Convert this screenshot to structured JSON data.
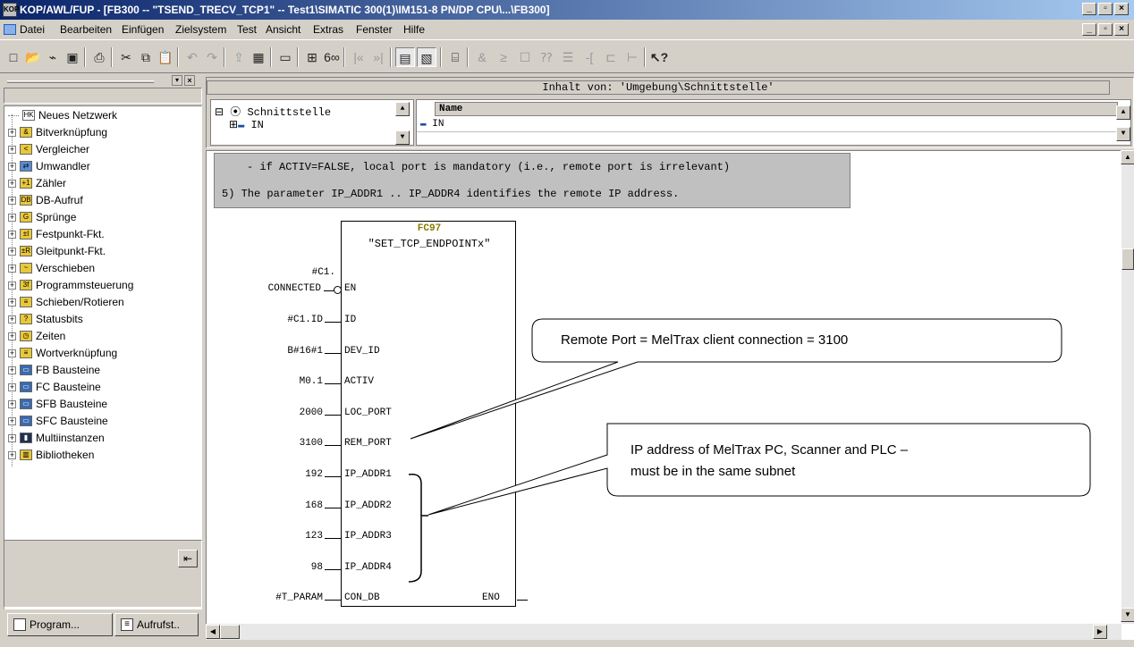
{
  "window": {
    "title": "KOP/AWL/FUP - [FB300 -- \"TSEND_TRECV_TCP1\" -- Test1\\SIMATIC 300(1)\\IM151-8 PN/DP CPU\\...\\FB300]"
  },
  "menu": [
    "Datei",
    "Bearbeiten",
    "Einfügen",
    "Zielsystem",
    "Test",
    "Ansicht",
    "Extras",
    "Fenster",
    "Hilfe"
  ],
  "toolbar_icons": [
    "new-icon",
    "open-icon",
    "accessible-nodes-icon",
    "save-icon",
    "print-icon",
    "cut-icon",
    "copy-icon",
    "paste-icon",
    "undo-icon",
    "redo-icon",
    "load-icon",
    "load-cpu-icon",
    "online-offline-icon",
    "monitor-icon",
    "glasses-icon",
    "prev-network-icon",
    "next-network-icon",
    "overview-icon",
    "details-icon",
    "network-icon",
    "and-box-icon",
    "or-box-icon",
    "empty-box-icon",
    "branch-icon",
    "open-branch-icon",
    "coil-icon",
    "contact-icon",
    "help-icon"
  ],
  "left_panel": {
    "tree": [
      {
        "label": "Neues Netzwerk",
        "icon": "new-network-icon",
        "expand": false
      },
      {
        "label": "Bitverknüpfung",
        "icon": "bit-logic-icon",
        "expand": true
      },
      {
        "label": "Vergleicher",
        "icon": "comparator-icon",
        "expand": true
      },
      {
        "label": "Umwandler",
        "icon": "converter-icon",
        "expand": true
      },
      {
        "label": "Zähler",
        "icon": "counter-icon",
        "expand": true
      },
      {
        "label": "DB-Aufruf",
        "icon": "db-call-icon",
        "expand": true
      },
      {
        "label": "Sprünge",
        "icon": "jump-icon",
        "expand": true
      },
      {
        "label": "Festpunkt-Fkt.",
        "icon": "fixed-point-icon",
        "expand": true
      },
      {
        "label": "Gleitpunkt-Fkt.",
        "icon": "floating-point-icon",
        "expand": true
      },
      {
        "label": "Verschieben",
        "icon": "move-icon",
        "expand": true
      },
      {
        "label": "Programmsteuerung",
        "icon": "program-control-icon",
        "expand": true
      },
      {
        "label": "Schieben/Rotieren",
        "icon": "shift-rotate-icon",
        "expand": true
      },
      {
        "label": "Statusbits",
        "icon": "status-bits-icon",
        "expand": true
      },
      {
        "label": "Zeiten",
        "icon": "timer-icon",
        "expand": true
      },
      {
        "label": "Wortverknüpfung",
        "icon": "word-logic-icon",
        "expand": true
      },
      {
        "label": "FB Bausteine",
        "icon": "fb-block-icon",
        "expand": true
      },
      {
        "label": "FC Bausteine",
        "icon": "fc-block-icon",
        "expand": true
      },
      {
        "label": "SFB Bausteine",
        "icon": "sfb-block-icon",
        "expand": true
      },
      {
        "label": "SFC Bausteine",
        "icon": "sfc-block-icon",
        "expand": true
      },
      {
        "label": "Multiinstanzen",
        "icon": "multi-instance-icon",
        "expand": true
      },
      {
        "label": "Bibliotheken",
        "icon": "library-icon",
        "expand": true
      }
    ],
    "tabs": [
      "Program...",
      "Aufrufst.."
    ]
  },
  "interface": {
    "header": "Inhalt von: 'Umgebung\\Schnittstelle'",
    "tree_root": "Schnittstelle",
    "tree_child": "IN",
    "grid_header": "Name",
    "grid_row": "IN"
  },
  "comment": {
    "line1": "- if ACTIV=FALSE, local port is mandatory (i.e., remote port is irrelevant)",
    "line2": "5) The parameter IP_ADDR1 .. IP_ADDR4 identifies the remote IP address."
  },
  "block": {
    "number": "FC97",
    "name": "\"SET_TCP_ENDPOINTx\"",
    "inputs": [
      {
        "param": "EN",
        "value1": "#C1.",
        "value2": "CONNECTED"
      },
      {
        "param": "ID",
        "value": "#C1.ID"
      },
      {
        "param": "DEV_ID",
        "value": "B#16#1"
      },
      {
        "param": "ACTIV",
        "value": "M0.1"
      },
      {
        "param": "LOC_PORT",
        "value": "2000"
      },
      {
        "param": "REM_PORT",
        "value": "3100"
      },
      {
        "param": "IP_ADDR1",
        "value": "192"
      },
      {
        "param": "IP_ADDR2",
        "value": "168"
      },
      {
        "param": "IP_ADDR3",
        "value": "123"
      },
      {
        "param": "IP_ADDR4",
        "value": "98"
      },
      {
        "param": "CON_DB",
        "value": "#T_PARAM"
      }
    ],
    "output": "ENO"
  },
  "callouts": {
    "remote_port": "Remote Port = MelTrax client connection = 3100",
    "ip_line1": "IP address of MelTrax PC, Scanner and PLC  –",
    "ip_line2": "must be in the same subnet"
  }
}
